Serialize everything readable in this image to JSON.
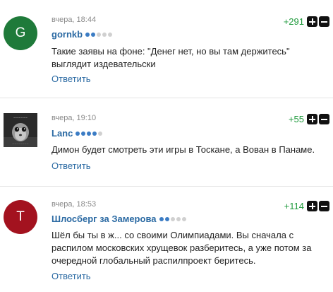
{
  "comments": [
    {
      "avatar_letter": "G",
      "avatar_color": "#1f7a3a",
      "time": "вчера, 18:44",
      "username": "gornkb",
      "rating_dots": [
        true,
        true,
        false,
        false,
        false
      ],
      "score": "+291",
      "text": "Такие заявы на фоне: \"Денег нет, но вы там держитесь\" выглядит издевательски",
      "reply": "Ответить"
    },
    {
      "avatar_letter": "",
      "avatar_color": "#2a2a2a",
      "time": "вчера, 19:10",
      "username": "Lanc",
      "rating_dots": [
        true,
        true,
        true,
        true,
        false
      ],
      "score": "+55",
      "text": "Димон будет смотреть эти игры в Тоскане, а Вован в Панаме.",
      "reply": "Ответить"
    },
    {
      "avatar_letter": "T",
      "avatar_color": "#a3121f",
      "time": "вчера, 18:53",
      "username": "Шлосберг за Замерова",
      "rating_dots": [
        true,
        true,
        false,
        false,
        false
      ],
      "score": "+114",
      "text": "Шёл бы ты в ж... со своими Олимпиадами. Вы сначала с распилом московских хрущевок разберитесь, а уже потом за очередной глобальный распилпроект беритесь.",
      "reply": "Ответить"
    }
  ]
}
